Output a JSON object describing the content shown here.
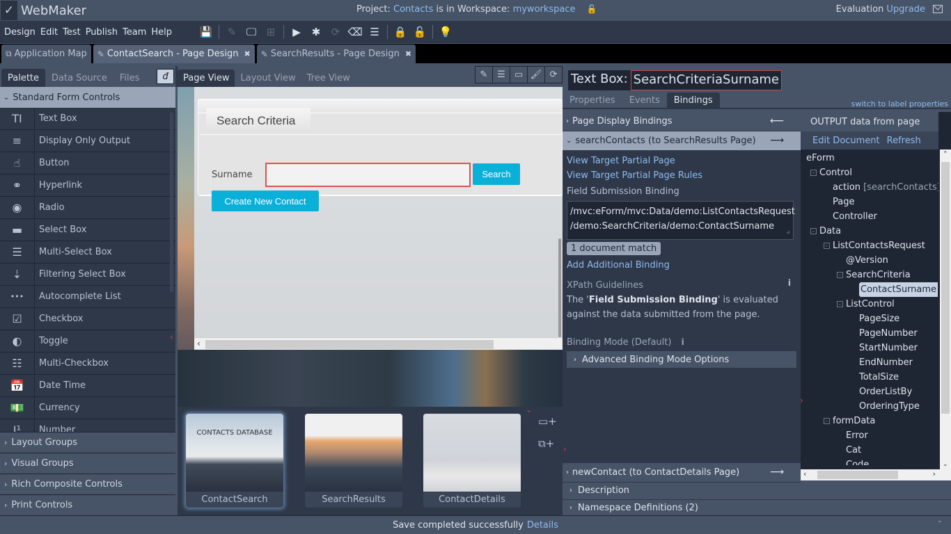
{
  "app": {
    "title": "WebMaker",
    "project_prefix": "Project:",
    "project_name": "Contacts",
    "workspace_prefix": "is in Workspace:",
    "workspace_name": "myworkspace",
    "evaluation_label": "Evaluation",
    "upgrade_label": "Upgrade"
  },
  "menu": [
    "Design",
    "Edit",
    "Test",
    "Publish",
    "Team",
    "Help"
  ],
  "toolbar": [
    {
      "icon": "save-icon",
      "glyph": "💾",
      "enabled": true
    },
    {
      "icon": "edit-icon",
      "glyph": "✎",
      "enabled": false
    },
    {
      "icon": "monitor-icon",
      "glyph": "🖵",
      "enabled": true
    },
    {
      "icon": "sitemap-icon",
      "glyph": "⊞",
      "enabled": false
    },
    {
      "icon": "play-icon",
      "glyph": "▶",
      "enabled": true
    },
    {
      "icon": "bug-icon",
      "glyph": "✱",
      "enabled": true
    },
    {
      "icon": "refresh-icon",
      "glyph": "⟳",
      "enabled": false
    },
    {
      "icon": "eraser-icon",
      "glyph": "⌫",
      "enabled": true
    },
    {
      "icon": "server-icon",
      "glyph": "☰",
      "enabled": true
    },
    {
      "icon": "lock-icon",
      "glyph": "🔒",
      "enabled": true
    },
    {
      "icon": "unlock-icon",
      "glyph": "🔓",
      "enabled": false
    },
    {
      "icon": "lightbulb-icon",
      "glyph": "💡",
      "enabled": true
    }
  ],
  "doc_tabs": [
    {
      "label": "Application Map",
      "icon": "map-icon",
      "closable": false,
      "active": false
    },
    {
      "label": "ContactSearch - Page Design",
      "icon": "edit-icon",
      "closable": true,
      "active": true
    },
    {
      "label": "SearchResults - Page Design",
      "icon": "edit-icon",
      "closable": true,
      "active": false
    }
  ],
  "left_panel": {
    "tabs": [
      "Palette",
      "Data Source",
      "Files"
    ],
    "active_tab": "Palette",
    "standard_header": "Standard Form Controls",
    "palette_items": [
      {
        "label": "Text Box",
        "icon": "textbox-icon",
        "glyph": "TI"
      },
      {
        "label": "Display Only Output",
        "icon": "display-output-icon",
        "glyph": "≡"
      },
      {
        "label": "Button",
        "icon": "pointer-hand-icon",
        "glyph": "☝"
      },
      {
        "label": "Hyperlink",
        "icon": "link-icon",
        "glyph": "⚭"
      },
      {
        "label": "Radio",
        "icon": "radio-icon",
        "glyph": "◉"
      },
      {
        "label": "Select Box",
        "icon": "select-box-icon",
        "glyph": "▬"
      },
      {
        "label": "Multi-Select Box",
        "icon": "multi-select-icon",
        "glyph": "☰"
      },
      {
        "label": "Filtering Select Box",
        "icon": "filter-sort-icon",
        "glyph": "⇣"
      },
      {
        "label": "Autocomplete List",
        "icon": "ellipsis-icon",
        "glyph": "•••"
      },
      {
        "label": "Checkbox",
        "icon": "checkbox-icon",
        "glyph": "☑"
      },
      {
        "label": "Toggle",
        "icon": "toggle-icon",
        "glyph": "◐"
      },
      {
        "label": "Multi-Checkbox",
        "icon": "list-icon",
        "glyph": "☷"
      },
      {
        "label": "Date Time",
        "icon": "calendar-icon",
        "glyph": "📅"
      },
      {
        "label": "Currency",
        "icon": "money-icon",
        "glyph": "💵"
      },
      {
        "label": "Number",
        "icon": "number-icon",
        "glyph": "I¹"
      }
    ],
    "groups": [
      "Layout Groups",
      "Visual Groups",
      "Rich Composite Controls",
      "Print Controls"
    ]
  },
  "center": {
    "tabs": [
      "Page View",
      "Layout View",
      "Tree View"
    ],
    "active_tab": "Page View",
    "tools": [
      {
        "icon": "edit-icon",
        "glyph": "✎"
      },
      {
        "icon": "list-icon",
        "glyph": "☰"
      },
      {
        "icon": "card-icon",
        "glyph": "▭"
      },
      {
        "icon": "brush-icon",
        "glyph": "🖌"
      },
      {
        "icon": "refresh-icon",
        "glyph": "⟳"
      }
    ],
    "form": {
      "legend": "Search Criteria",
      "surname_label": "Surname",
      "surname_value": "",
      "search_button": "Search",
      "create_button": "Create New Contact"
    },
    "thumbnails": [
      {
        "label": "ContactSearch",
        "caption": "CONTACTS DATABASE",
        "active": true
      },
      {
        "label": "SearchResults",
        "caption": "",
        "active": false
      },
      {
        "label": "ContactDetails",
        "caption": "",
        "active": false
      }
    ]
  },
  "right_panel": {
    "type_label": "Text Box:",
    "control_name": "SearchCriteriaSurname",
    "tabs": [
      "Properties",
      "Events",
      "Bindings"
    ],
    "active_tab": "Bindings",
    "switch_link": "switch to label properties",
    "page_display_bindings": "Page Display Bindings",
    "search_binding": "searchContacts (to SearchResults Page)",
    "view_partial": "View Target Partial Page",
    "view_partial_rules": "View Target Partial Page Rules",
    "field_submission_label": "Field Submission Binding",
    "xpath_line1": "/mvc:eForm/mvc:Data/demo:ListContactsRequest",
    "xpath_line2": "/demo:SearchCriteria/demo:ContactSurname",
    "match_badge": "1 document match",
    "add_binding": "Add Additional Binding",
    "xpath_guidelines_title": "XPath Guidelines",
    "guide_pre": "The '",
    "guide_bold": "Field Submission Binding",
    "guide_post": "' is evaluated against the data submitted from the page.",
    "binding_mode": "Binding Mode (Default)",
    "advanced_options": "Advanced Binding Mode Options",
    "new_contact_binding": "newContact (to ContactDetails Page)",
    "description": "Description",
    "namespace_defs": "Namespace Definitions (2)",
    "tree_header": "OUTPUT data from page",
    "edit_document": "Edit Document",
    "refresh": "Refresh",
    "tree": [
      {
        "label": "eForm",
        "depth": 0,
        "toggle": false
      },
      {
        "label": "Control",
        "depth": 1,
        "toggle": true
      },
      {
        "label": "action",
        "suffix": "[searchContacts]",
        "depth": 2,
        "toggle": false
      },
      {
        "label": "Page",
        "depth": 2,
        "toggle": false
      },
      {
        "label": "Controller",
        "depth": 2,
        "toggle": false
      },
      {
        "label": "Data",
        "depth": 1,
        "toggle": true
      },
      {
        "label": "ListContactsRequest",
        "depth": 2,
        "toggle": true
      },
      {
        "label": "@Version",
        "depth": 3,
        "toggle": false
      },
      {
        "label": "SearchCriteria",
        "depth": 3,
        "toggle": true
      },
      {
        "label": "ContactSurname",
        "depth": 4,
        "toggle": false,
        "selected": true
      },
      {
        "label": "ListControl",
        "depth": 3,
        "toggle": true
      },
      {
        "label": "PageSize",
        "depth": 4,
        "toggle": false
      },
      {
        "label": "PageNumber",
        "depth": 4,
        "toggle": false
      },
      {
        "label": "StartNumber",
        "depth": 4,
        "toggle": false
      },
      {
        "label": "EndNumber",
        "depth": 4,
        "toggle": false
      },
      {
        "label": "TotalSize",
        "depth": 4,
        "toggle": false
      },
      {
        "label": "OrderListBy",
        "depth": 4,
        "toggle": false
      },
      {
        "label": "OrderingType",
        "depth": 4,
        "toggle": false
      },
      {
        "label": "formData",
        "depth": 2,
        "toggle": true
      },
      {
        "label": "Error",
        "depth": 3,
        "toggle": false
      },
      {
        "label": "Cat",
        "depth": 3,
        "toggle": false
      },
      {
        "label": "Code",
        "depth": 3,
        "toggle": false
      }
    ]
  },
  "status": {
    "message": "Save completed successfully",
    "details_link": "Details"
  },
  "colors": {
    "accent_button": "#0bb0d8",
    "selection_border": "#d9534f",
    "link": "#8fbbef"
  }
}
